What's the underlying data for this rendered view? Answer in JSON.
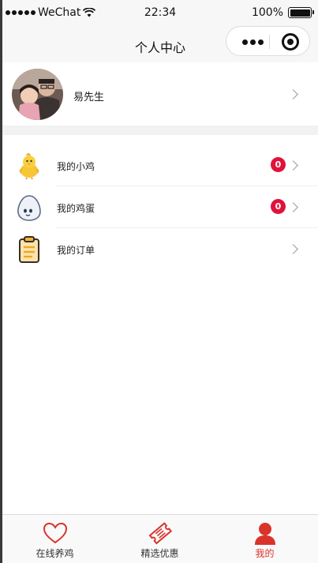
{
  "status_bar": {
    "carrier": "WeChat",
    "time": "22:34",
    "battery": "100%"
  },
  "nav": {
    "title": "个人中心"
  },
  "profile": {
    "name": "易先生"
  },
  "menu": [
    {
      "label": "我的小鸡",
      "badge": "0",
      "icon": "chick-icon"
    },
    {
      "label": "我的鸡蛋",
      "badge": "0",
      "icon": "egg-icon"
    },
    {
      "label": "我的订单",
      "badge": null,
      "icon": "clipboard-icon"
    }
  ],
  "tabs": [
    {
      "label": "在线养鸡",
      "icon": "heart-icon",
      "active": false
    },
    {
      "label": "精选优惠",
      "icon": "ticket-icon",
      "active": false
    },
    {
      "label": "我的",
      "icon": "person-icon",
      "active": true
    }
  ],
  "colors": {
    "accent": "#d9342b",
    "badge": "#e0123a",
    "bar_bg": "#f7f7f7"
  }
}
